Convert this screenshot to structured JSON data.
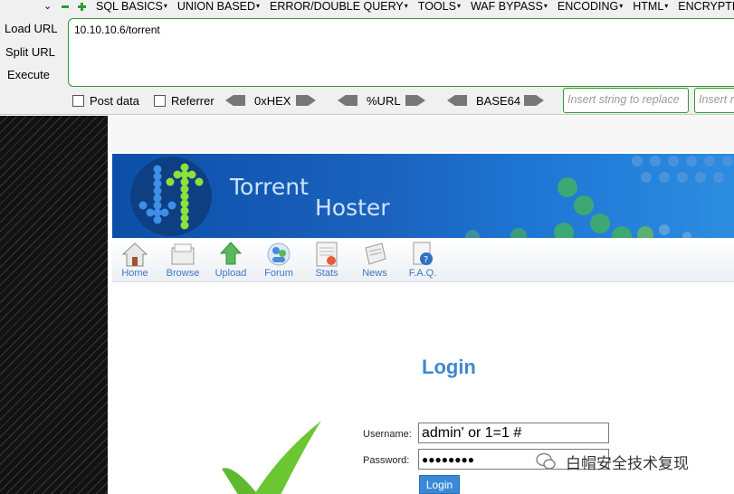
{
  "hackbar": {
    "menu_items": [
      "SQL BASICS",
      "UNION BASED",
      "ERROR/DOUBLE QUERY",
      "TOOLS",
      "WAF BYPASS",
      "ENCODING",
      "HTML",
      "ENCRYPTION"
    ],
    "commands": {
      "load_url": "Load URL",
      "split_url": "Split URL",
      "execute": "Execute"
    },
    "url_value": "10.10.10.6/torrent",
    "post_data_label": "Post data",
    "referrer_label": "Referrer",
    "hex_label": "0xHEX",
    "url_enc_label": "%URL",
    "base64_label": "BASE64",
    "replace_placeholder": "Insert string to replace",
    "replace_with_placeholder": "Insert replacing string",
    "accent_color": "#2e9a2e"
  },
  "site": {
    "brand_line1": "Torrent",
    "brand_line2": "Hoster",
    "nav": [
      {
        "label": "Home",
        "icon": "home-icon"
      },
      {
        "label": "Browse",
        "icon": "browse-icon"
      },
      {
        "label": "Upload",
        "icon": "upload-icon"
      },
      {
        "label": "Forum",
        "icon": "forum-icon"
      },
      {
        "label": "Stats",
        "icon": "stats-icon"
      },
      {
        "label": "News",
        "icon": "news-icon"
      },
      {
        "label": "F.A.Q.",
        "icon": "faq-icon"
      }
    ]
  },
  "login": {
    "title": "Login",
    "username_label": "Username:",
    "username_value": "admin' or 1=1 #",
    "password_label": "Password:",
    "password_value": "●●●●●●●●",
    "submit_label": "Login"
  },
  "watermark": {
    "text": "白帽安全技术复现"
  }
}
